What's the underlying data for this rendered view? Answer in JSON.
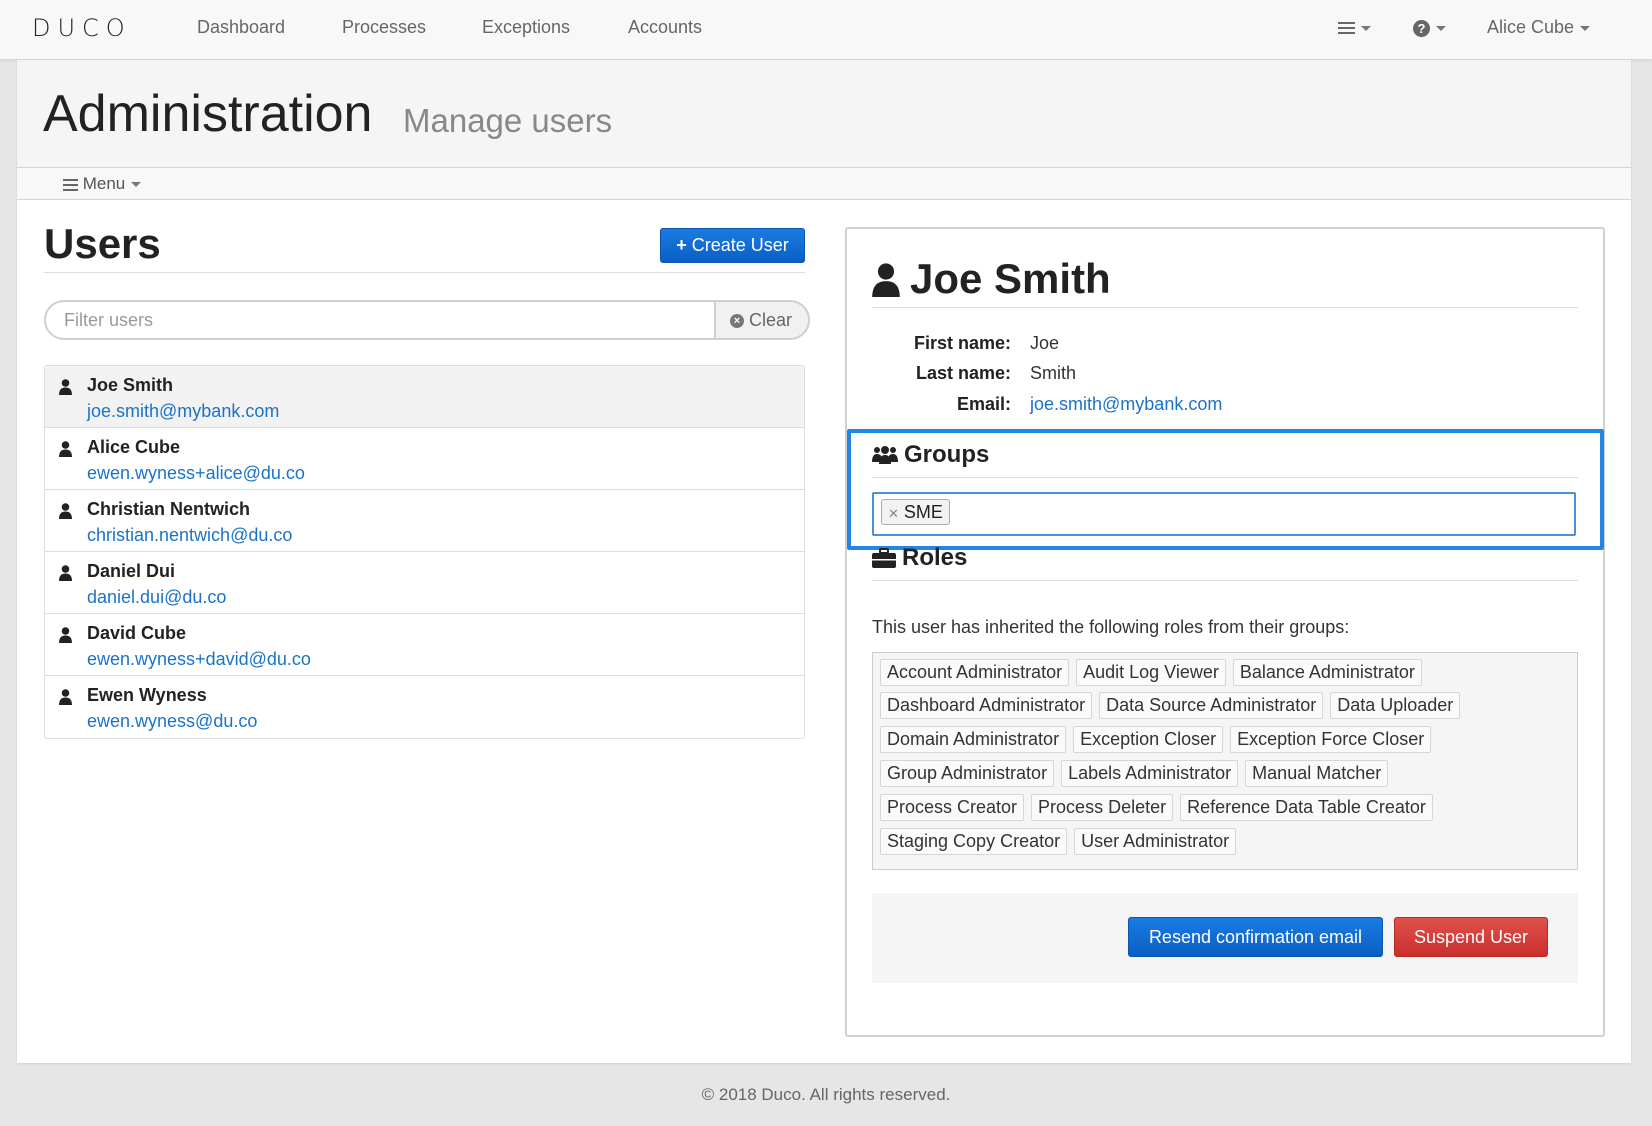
{
  "navbar": {
    "brand": "DUCO",
    "links": [
      "Dashboard",
      "Processes",
      "Exceptions",
      "Accounts"
    ],
    "user_menu": "Alice Cube"
  },
  "header": {
    "title": "Administration",
    "subtitle": "Manage users",
    "menu_label": "Menu"
  },
  "users": {
    "title": "Users",
    "create_button": "Create User",
    "filter_placeholder": "Filter users",
    "clear_label": "Clear",
    "items": [
      {
        "name": "Joe Smith",
        "email": "joe.smith@mybank.com"
      },
      {
        "name": "Alice Cube",
        "email": "ewen.wyness+alice@du.co"
      },
      {
        "name": "Christian Nentwich",
        "email": "christian.nentwich@du.co"
      },
      {
        "name": "Daniel Dui",
        "email": "daniel.dui@du.co"
      },
      {
        "name": "David Cube",
        "email": "ewen.wyness+david@du.co"
      },
      {
        "name": "Ewen Wyness",
        "email": "ewen.wyness@du.co"
      }
    ]
  },
  "detail": {
    "name": "Joe Smith",
    "first_name_label": "First name:",
    "first_name": "Joe",
    "last_name_label": "Last name:",
    "last_name": "Smith",
    "email_label": "Email:",
    "email": "joe.smith@mybank.com",
    "groups_title": "Groups",
    "groups": [
      "SME"
    ],
    "roles_title": "Roles",
    "roles_description": "This user has inherited the following roles from their groups:",
    "roles": [
      [
        "Account Administrator",
        "Audit Log Viewer",
        "Balance Administrator"
      ],
      [
        "Dashboard Administrator",
        "Data Source Administrator",
        "Data Uploader"
      ],
      [
        "Domain Administrator",
        "Exception Closer",
        "Exception Force Closer"
      ],
      [
        "Group Administrator",
        "Labels Administrator",
        "Manual Matcher"
      ],
      [
        "Process Creator",
        "Process Deleter",
        "Reference Data Table Creator"
      ],
      [
        "Staging Copy Creator",
        "User Administrator"
      ]
    ],
    "resend_button": "Resend confirmation email",
    "suspend_button": "Suspend User"
  },
  "footer": {
    "text": "© 2018 Duco. All rights reserved."
  },
  "colors": {
    "primary": "#1a73c9",
    "danger": "#d9534f",
    "highlight": "#2286e6"
  }
}
